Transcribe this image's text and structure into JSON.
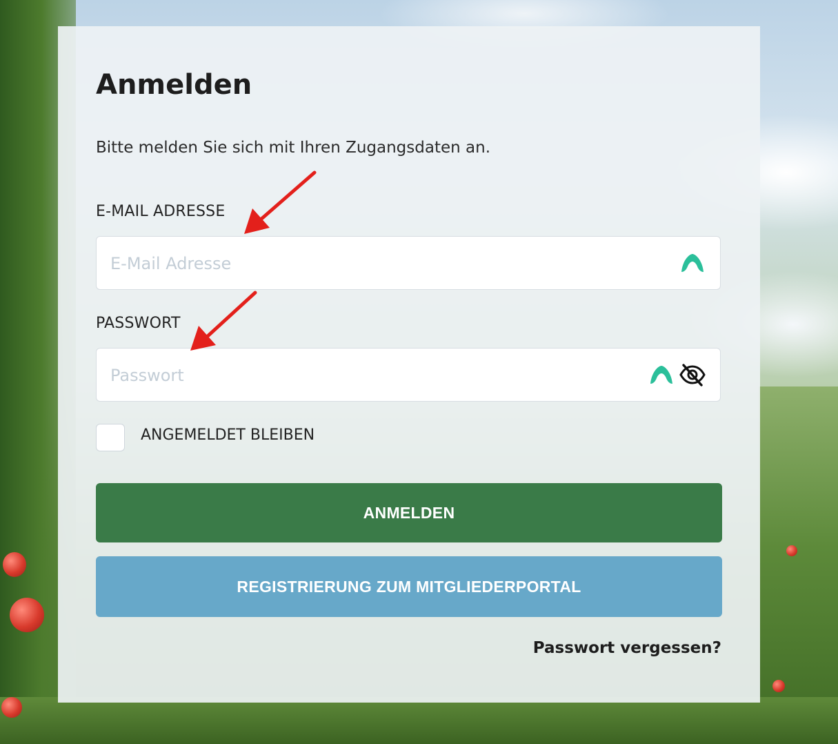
{
  "login": {
    "title": "Anmelden",
    "subtitle": "Bitte melden Sie sich mit Ihren Zugangsdaten an.",
    "email": {
      "label": "E-MAIL ADRESSE",
      "placeholder": "E-Mail Adresse",
      "value": ""
    },
    "password": {
      "label": "PASSWORT",
      "placeholder": "Passwort",
      "value": ""
    },
    "remember": {
      "label": "ANGEMELDET BLEIBEN",
      "checked": false
    },
    "login_button": "ANMELDEN",
    "register_button": "REGISTRIERUNG ZUM MITGLIEDERPORTAL",
    "forgot_link": "Passwort vergessen?"
  },
  "icons": {
    "password_manager": "password-manager-icon",
    "toggle_visibility": "eye-slash-icon",
    "annotation": "red-arrow"
  },
  "colors": {
    "login_button": "#3a7b48",
    "register_button": "#67a8c9",
    "password_manager_icon": "#2bbf9a",
    "annotation_arrow": "#e3201b"
  }
}
